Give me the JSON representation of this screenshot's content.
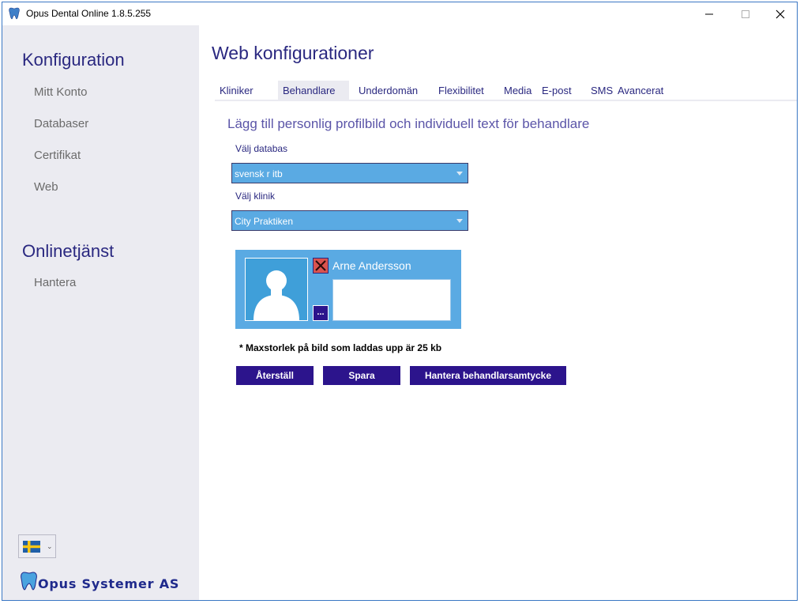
{
  "window": {
    "title": "Opus Dental Online 1.8.5.255",
    "minimize_glyph": "—",
    "maximize_glyph": "□",
    "close_glyph": "✕"
  },
  "sidebar": {
    "config_heading": "Konfiguration",
    "config_items": [
      {
        "label": "Mitt Konto"
      },
      {
        "label": "Databaser"
      },
      {
        "label": "Certifikat"
      },
      {
        "label": "Web"
      }
    ],
    "online_heading": "Onlinetjänst",
    "online_items": [
      {
        "label": "Hantera"
      }
    ],
    "language_icon": "swedish-flag-icon",
    "logo_text": "Opus Systemer AS"
  },
  "main": {
    "title": "Web konfigurationer",
    "tabs": [
      {
        "label": "Kliniker"
      },
      {
        "label": "Behandlare"
      },
      {
        "label": "Underdomän"
      },
      {
        "label": "Flexibilitet"
      },
      {
        "label": "Media"
      },
      {
        "label": "E-post"
      },
      {
        "label": "SMS"
      },
      {
        "label": "Avancerat"
      }
    ],
    "active_tab": "Behandlare",
    "section_heading": "Lägg till personlig profilbild och individuell text för behandlare",
    "database_label": "Välj databas",
    "database_value": "svensk r itb",
    "clinic_label": "Välj klinik",
    "clinic_value": "City Praktiken",
    "practitioner": {
      "name": "Arne Andersson",
      "text": "",
      "more_label": "..."
    },
    "note": "* Maxstorlek på bild som laddas upp är 25 kb",
    "buttons": {
      "reset": "Återställ",
      "save": "Spara",
      "consent": "Hantera behandlarsamtycke"
    }
  },
  "colors": {
    "accent_dark": "#2c148c",
    "dropdown_blue": "#5aaae3",
    "heading_purple": "#2a2880",
    "sidebar_bg": "#ebebf1"
  }
}
